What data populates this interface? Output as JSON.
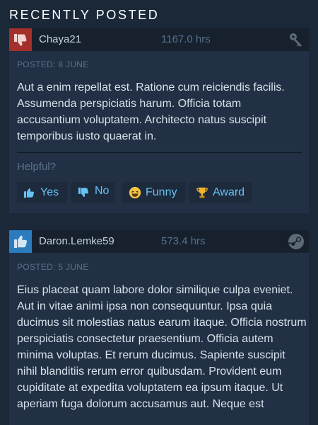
{
  "section": {
    "title": "RECENTLY POSTED"
  },
  "reviews": [
    {
      "recommend": "down",
      "user": "Chaya21",
      "hours": "1167.0 hrs",
      "platform_icon": "key-icon",
      "posted": "POSTED: 8 JUNE",
      "body": "Aut a enim repellat est. Ratione cum reiciendis facilis. Assumenda perspiciatis harum. Officia totam accusantium voluptatem. Architecto natus suscipit temporibus iusto quaerat in.",
      "helpful_question": "Helpful?",
      "buttons": {
        "yes": "Yes",
        "no": "No",
        "funny": "Funny",
        "award": "Award"
      }
    },
    {
      "recommend": "up",
      "user": "Daron.Lemke59",
      "hours": "573.4 hrs",
      "platform_icon": "steam-icon",
      "posted": "POSTED: 5 JUNE",
      "body": "Eius placeat quam labore dolor similique culpa eveniet. Aut in vitae animi ipsa non consequuntur. Ipsa quia ducimus sit molestias natus earum itaque. Officia nostrum perspiciatis consectetur praesentium. Officia autem minima voluptas. Et rerum ducimus. Sapiente suscipit nihil blanditiis rerum error quibusdam. Provident eum cupiditate at expedita voluptatem ea ipsum itaque. Ut aperiam fuga dolorum accusamus aut. Neque est"
    }
  ],
  "colors": {
    "background": "#1b2838",
    "panel": "#213044",
    "header": "#17212e",
    "thumb_down": "#a3302a",
    "thumb_up": "#2b7bbd",
    "link": "#67c1f5"
  }
}
